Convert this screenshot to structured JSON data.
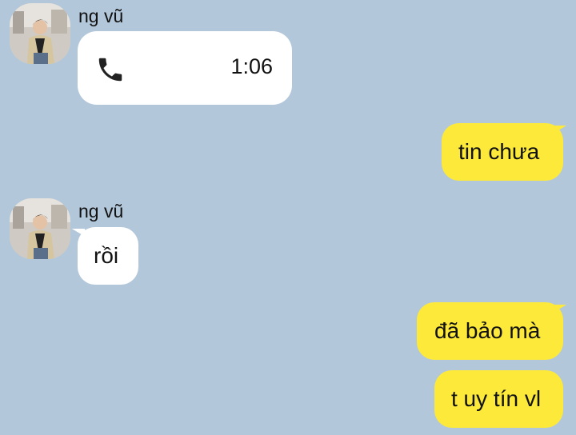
{
  "messages": [
    {
      "sender": "ng vũ",
      "type": "call",
      "icon": "phone-icon",
      "duration": "1:06"
    },
    {
      "sender": "me",
      "type": "text",
      "text": "tin chưa"
    },
    {
      "sender": "ng vũ",
      "type": "text",
      "text": "rồi"
    },
    {
      "sender": "me",
      "type": "text",
      "text": "đã bảo mà"
    },
    {
      "sender": "me",
      "type": "text",
      "text": "t uy tín vl"
    }
  ],
  "colors": {
    "background": "#b2c7da",
    "incoming_bubble": "#ffffff",
    "outgoing_bubble": "#fde93a"
  }
}
